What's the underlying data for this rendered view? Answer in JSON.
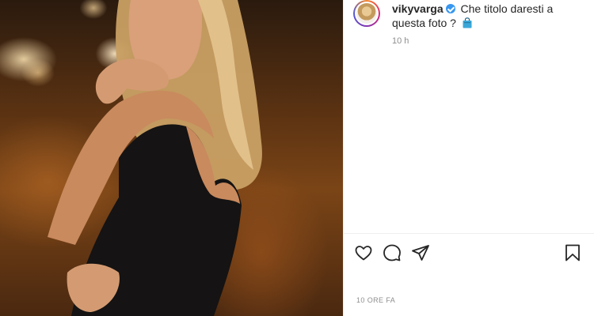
{
  "post": {
    "username": "vikyvarga",
    "caption": "Che titolo daresti a questa foto ?",
    "time_ago": "10 h",
    "date_label": "10 ORE FA"
  },
  "icons": {
    "verified": "verified-badge-icon",
    "caption_emoji": "shopping-bag-icon",
    "like": "heart-icon",
    "comment": "comment-icon",
    "share": "paper-plane-icon",
    "save": "bookmark-icon"
  },
  "colors": {
    "verified_blue": "#3897f0",
    "text_primary": "#262626",
    "text_secondary": "#8e8e8e",
    "divider": "#efefef"
  }
}
